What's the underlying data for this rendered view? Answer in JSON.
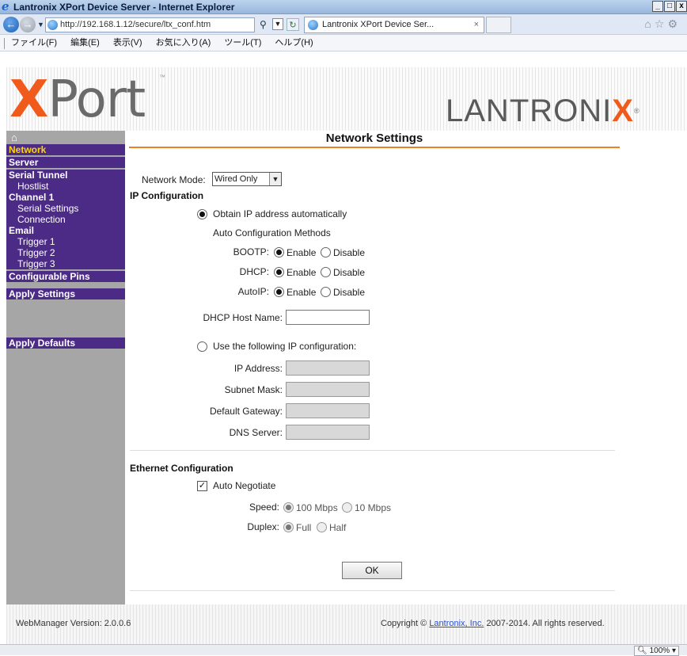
{
  "browser": {
    "window_title": "Lantronix XPort Device Server - Internet Explorer",
    "window_buttons": [
      "_",
      "□",
      "x"
    ],
    "url": "http://192.168.1.12/secure/ltx_conf.htm",
    "tab_title": "Lantronix XPort Device Ser...",
    "tab_close": "×",
    "menu": [
      "ファイル(F)",
      "編集(E)",
      "表示(V)",
      "お気に入り(A)",
      "ツール(T)",
      "ヘルプ(H)"
    ],
    "zoom": "100%"
  },
  "banner": {
    "logo_x": "X",
    "logo_rest": "Port",
    "logo_tm": "™",
    "brand_pre": "LANTRONI",
    "brand_x": "X",
    "brand_reg": "®"
  },
  "sidebar": {
    "home_icon": "⌂",
    "items": [
      {
        "label": "Network"
      },
      {
        "label": "Server"
      },
      {
        "label": "Serial Tunnel"
      },
      {
        "label": "Hostlist"
      },
      {
        "label": "Channel 1"
      },
      {
        "label": "Serial Settings"
      },
      {
        "label": "Connection"
      },
      {
        "label": "Email"
      },
      {
        "label": "Trigger 1"
      },
      {
        "label": "Trigger 2"
      },
      {
        "label": "Trigger 3"
      },
      {
        "label": "Configurable Pins"
      },
      {
        "label": "Apply Settings"
      },
      {
        "label": "Apply Defaults"
      }
    ]
  },
  "main": {
    "title": "Network Settings",
    "network_mode_label": "Network Mode:",
    "network_mode_value": "Wired Only",
    "ip_config_heading": "IP Configuration",
    "obtain_auto_label": "Obtain IP address automatically",
    "auto_methods_label": "Auto Configuration Methods",
    "bootp_label": "BOOTP:",
    "dhcp_label": "DHCP:",
    "autoip_label": "AutoIP:",
    "enable": "Enable",
    "disable": "Disable",
    "dhcp_host_label": "DHCP Host Name:",
    "dhcp_host_value": "",
    "use_following_label": "Use the following IP configuration:",
    "ip_address_label": "IP Address:",
    "subnet_mask_label": "Subnet Mask:",
    "gateway_label": "Default Gateway:",
    "dns_label": "DNS Server:",
    "ethernet_heading": "Ethernet Configuration",
    "auto_negotiate_label": "Auto Negotiate",
    "speed_label": "Speed:",
    "speed_100": "100 Mbps",
    "speed_10": "10 Mbps",
    "duplex_label": "Duplex:",
    "duplex_full": "Full",
    "duplex_half": "Half",
    "ok_label": "OK"
  },
  "footer": {
    "version": "WebManager Version: 2.0.0.6",
    "copyright_pre": "Copyright © ",
    "company_link": "Lantronix, Inc.",
    "copyright_post": " 2007-2014. All rights reserved."
  },
  "colors": {
    "sidebar_purple": "#4b2b86",
    "active_yellow": "#ffd700",
    "accent_orange": "#f05a1a"
  }
}
